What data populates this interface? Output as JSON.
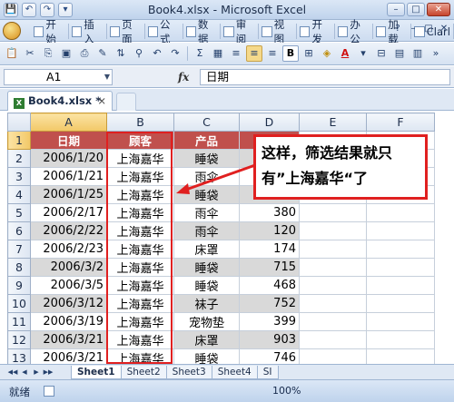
{
  "window": {
    "title": "Book4.xlsx - Microsoft Excel",
    "quick_access": [
      "💾",
      "↶",
      "↷",
      "▾"
    ],
    "controls": [
      "–",
      "□",
      "✕"
    ]
  },
  "ribbon_tabs": [
    {
      "label": "开始",
      "icon": "home-icon"
    },
    {
      "label": "插入",
      "icon": "insert-icon"
    },
    {
      "label": "页面",
      "icon": "page-icon"
    },
    {
      "label": "公式",
      "icon": "formula-icon"
    },
    {
      "label": "数据",
      "icon": "data-icon"
    },
    {
      "label": "审阅",
      "icon": "review-icon"
    },
    {
      "label": "视图",
      "icon": "view-icon"
    },
    {
      "label": "开发",
      "icon": "developer-icon"
    },
    {
      "label": "办公",
      "icon": "office-icon"
    },
    {
      "label": "加载",
      "icon": "addin-icon"
    },
    {
      "label": "Clarl",
      "icon": "clarl-icon"
    }
  ],
  "ribbon_right": [
    "?",
    "–",
    "□",
    "✕"
  ],
  "toolbar": {
    "bold_label": "B",
    "font_color_label": "A"
  },
  "formula_bar": {
    "cell_ref": "A1",
    "fx": "fx",
    "content": "日期"
  },
  "document_tab": {
    "label": "Book4.xlsx *",
    "close": "×"
  },
  "grid": {
    "columns": [
      "A",
      "B",
      "C",
      "D",
      "E",
      "F"
    ],
    "header_row": {
      "row": "1",
      "cells": [
        "日期",
        "顾客",
        "产品",
        "",
        "",
        ""
      ]
    },
    "rows": [
      {
        "row": "2",
        "date": "2006/1/20",
        "customer": "上海嘉华",
        "product": "睡袋",
        "amount": ""
      },
      {
        "row": "3",
        "date": "2006/1/21",
        "customer": "上海嘉华",
        "product": "雨伞",
        "amount": ""
      },
      {
        "row": "4",
        "date": "2006/1/25",
        "customer": "上海嘉华",
        "product": "睡袋",
        "amount": ""
      },
      {
        "row": "5",
        "date": "2006/2/17",
        "customer": "上海嘉华",
        "product": "雨伞",
        "amount": "380"
      },
      {
        "row": "6",
        "date": "2006/2/22",
        "customer": "上海嘉华",
        "product": "雨伞",
        "amount": "120"
      },
      {
        "row": "7",
        "date": "2006/2/23",
        "customer": "上海嘉华",
        "product": "床罩",
        "amount": "174"
      },
      {
        "row": "8",
        "date": "2006/3/2",
        "customer": "上海嘉华",
        "product": "睡袋",
        "amount": "715"
      },
      {
        "row": "9",
        "date": "2006/3/5",
        "customer": "上海嘉华",
        "product": "睡袋",
        "amount": "468"
      },
      {
        "row": "10",
        "date": "2006/3/12",
        "customer": "上海嘉华",
        "product": "袜子",
        "amount": "752"
      },
      {
        "row": "11",
        "date": "2006/3/19",
        "customer": "上海嘉华",
        "product": "宠物垫",
        "amount": "399"
      },
      {
        "row": "12",
        "date": "2006/3/21",
        "customer": "上海嘉华",
        "product": "床罩",
        "amount": "903"
      },
      {
        "row": "13",
        "date": "2006/3/21",
        "customer": "上海嘉华",
        "product": "睡袋",
        "amount": "746"
      }
    ]
  },
  "callout": {
    "text_line1": "这样，筛选结果就只",
    "text_line2": "有”上海嘉华“了"
  },
  "sheet_tabs": [
    "Sheet1",
    "Sheet2",
    "Sheet3",
    "Sheet4",
    "SI"
  ],
  "status": {
    "ready": "就绪",
    "zoom": "100%"
  },
  "colors": {
    "header_fill": "#c0504d",
    "annotation_red": "#e02020",
    "shaded_cell": "#d9d9d9"
  }
}
